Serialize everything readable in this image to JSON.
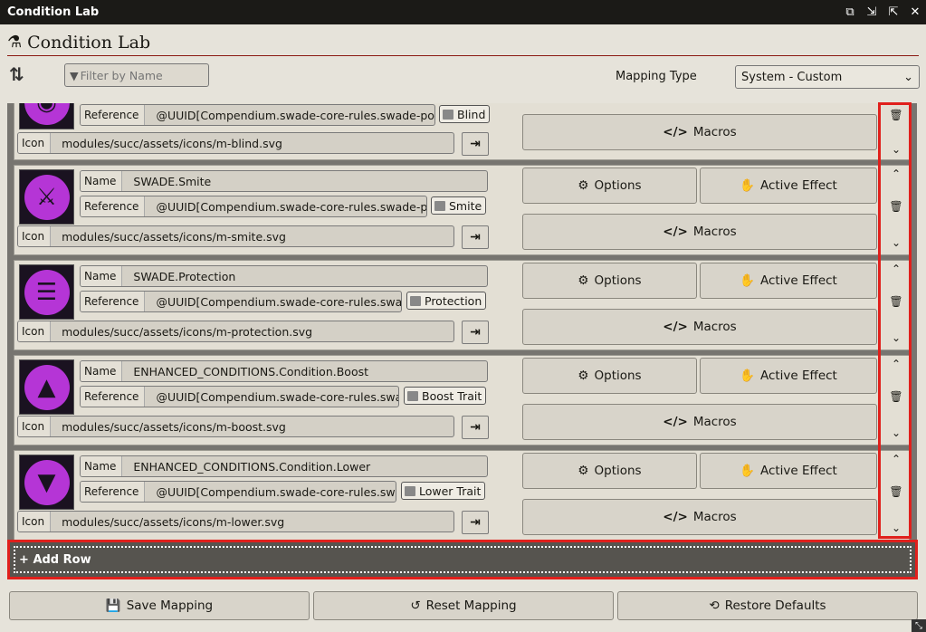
{
  "window": {
    "title": "Condition Lab",
    "controls": [
      "popout-icon",
      "import-icon",
      "export-icon",
      "close-icon"
    ]
  },
  "header": {
    "title": "Condition Lab"
  },
  "toolbar": {
    "filter_placeholder": "Filter by Name",
    "mapping_label": "Mapping Type",
    "mapping_value": "System - Custom"
  },
  "labels": {
    "name": "Name",
    "reference": "Reference",
    "icon": "Icon",
    "options": "Options",
    "active_effect": "Active Effect",
    "macros": "Macros"
  },
  "rows": [
    {
      "reference": "@UUID[Compendium.swade-core-rules.swade-powe",
      "badge": "Blind",
      "icon": "modules/succ/assets/icons/m-blind.svg"
    },
    {
      "name": "SWADE.Smite",
      "reference": "@UUID[Compendium.swade-core-rules.swade-powe",
      "badge": "Smite",
      "icon": "modules/succ/assets/icons/m-smite.svg"
    },
    {
      "name": "SWADE.Protection",
      "reference": "@UUID[Compendium.swade-core-rules.swade-",
      "badge": "Protection",
      "icon": "modules/succ/assets/icons/m-protection.svg"
    },
    {
      "name": "ENHANCED_CONDITIONS.Condition.Boost",
      "reference": "@UUID[Compendium.swade-core-rules.swade-",
      "badge": "Boost Trait",
      "icon": "modules/succ/assets/icons/m-boost.svg"
    },
    {
      "name": "ENHANCED_CONDITIONS.Condition.Lower",
      "reference": "@UUID[Compendium.swade-core-rules.swade",
      "badge": "Lower Trait",
      "icon": "modules/succ/assets/icons/m-lower.svg"
    }
  ],
  "add_row": {
    "label": "Add Row"
  },
  "footer": {
    "save": "Save Mapping",
    "reset": "Reset Mapping",
    "restore": "Restore Defaults"
  },
  "colors": {
    "highlight_border": "#e0201c",
    "icon_purple": "#b535d6",
    "header_rule": "#8b1a12"
  }
}
